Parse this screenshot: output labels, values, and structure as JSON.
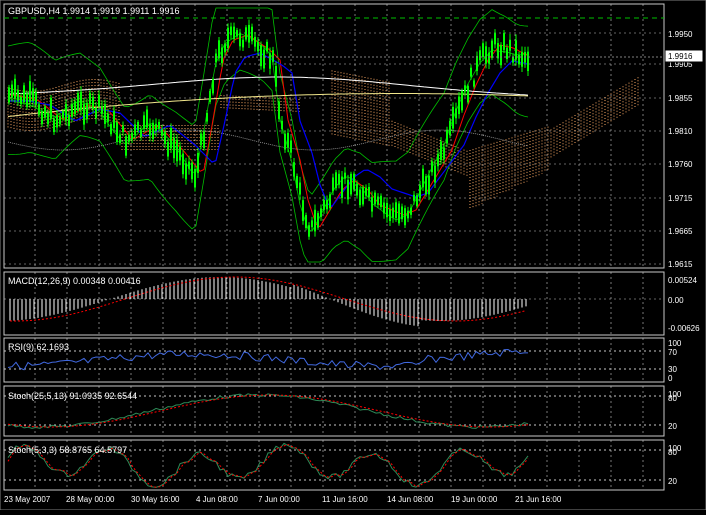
{
  "symbol_header": "GBPUSD,H4  1.9914 1.9919 1.9911 1.9916",
  "current_price": "1.9916",
  "price_axis": [
    "1.9950",
    "1.9905",
    "1.9855",
    "1.9810",
    "1.9760",
    "1.9715",
    "1.9665",
    "1.9615"
  ],
  "macd": {
    "label": "MACD(12,26,9) 0.00348 0.00416",
    "axis": [
      "0.00524",
      "0.00",
      "-0.00626"
    ]
  },
  "rsi": {
    "label": "RSI(9) 62.1693",
    "axis": [
      "100",
      "70",
      "30",
      "0"
    ]
  },
  "stoch1": {
    "label": "Stoch(25,5,13) 91.0935 92.6544",
    "axis": [
      "100",
      "80",
      "20"
    ]
  },
  "stoch2": {
    "label": "Stoch(5,3,3) 58.8765 64.5797",
    "axis": [
      "100",
      "80",
      "20"
    ]
  },
  "time_axis": [
    "23 May 2007",
    "28 May 00:00",
    "30 May 16:00",
    "4 Jun 08:00",
    "7 Jun 00:00",
    "11 Jun 16:00",
    "14 Jun 08:00",
    "19 Jun 00:00",
    "21 Jun 16:00"
  ],
  "colors": {
    "background": "#000000",
    "grid": "#c8c8c8",
    "axis_text": "#ffffff",
    "candle_bull": "#00ff00",
    "bollinger": "#00c000",
    "ma_red": "#ff0000",
    "ma_blue": "#0000ff",
    "ma_white": "#ffffff",
    "ma_khaki": "#f0e68c",
    "ichimoku_cloud": "#f4a460",
    "macd_hist": "#ffffff",
    "macd_signal": "#ff0000",
    "rsi_line": "#4169e1",
    "stoch_main": "#2e8b57",
    "stoch_signal": "#ff0000"
  }
}
